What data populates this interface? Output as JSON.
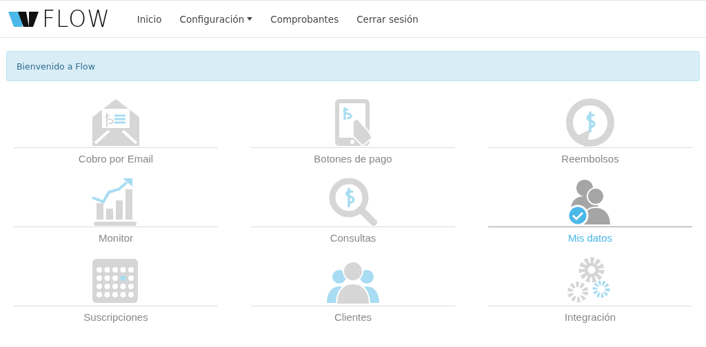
{
  "brand": {
    "name": "FLOW"
  },
  "nav": [
    {
      "label": "Inicio",
      "dropdown": false
    },
    {
      "label": "Configuración",
      "dropdown": true
    },
    {
      "label": "Comprobantes",
      "dropdown": false
    },
    {
      "label": "Cerrar sesión",
      "dropdown": false
    }
  ],
  "alert": {
    "text": "Bienvenido a Flow"
  },
  "tiles": [
    {
      "label": "Cobro por Email",
      "kind": "email",
      "selected": false
    },
    {
      "label": "Botones de pago",
      "kind": "tablet",
      "selected": false
    },
    {
      "label": "Reembolsos",
      "kind": "refund",
      "selected": false
    },
    {
      "label": "Monitor",
      "kind": "chart",
      "selected": false
    },
    {
      "label": "Consultas",
      "kind": "search",
      "selected": false
    },
    {
      "label": "Mis datos",
      "kind": "users",
      "selected": true
    },
    {
      "label": "Suscripciones",
      "kind": "calendar",
      "selected": false
    },
    {
      "label": "Clientes",
      "kind": "people",
      "selected": false
    },
    {
      "label": "Integración",
      "kind": "gears",
      "selected": false
    }
  ]
}
